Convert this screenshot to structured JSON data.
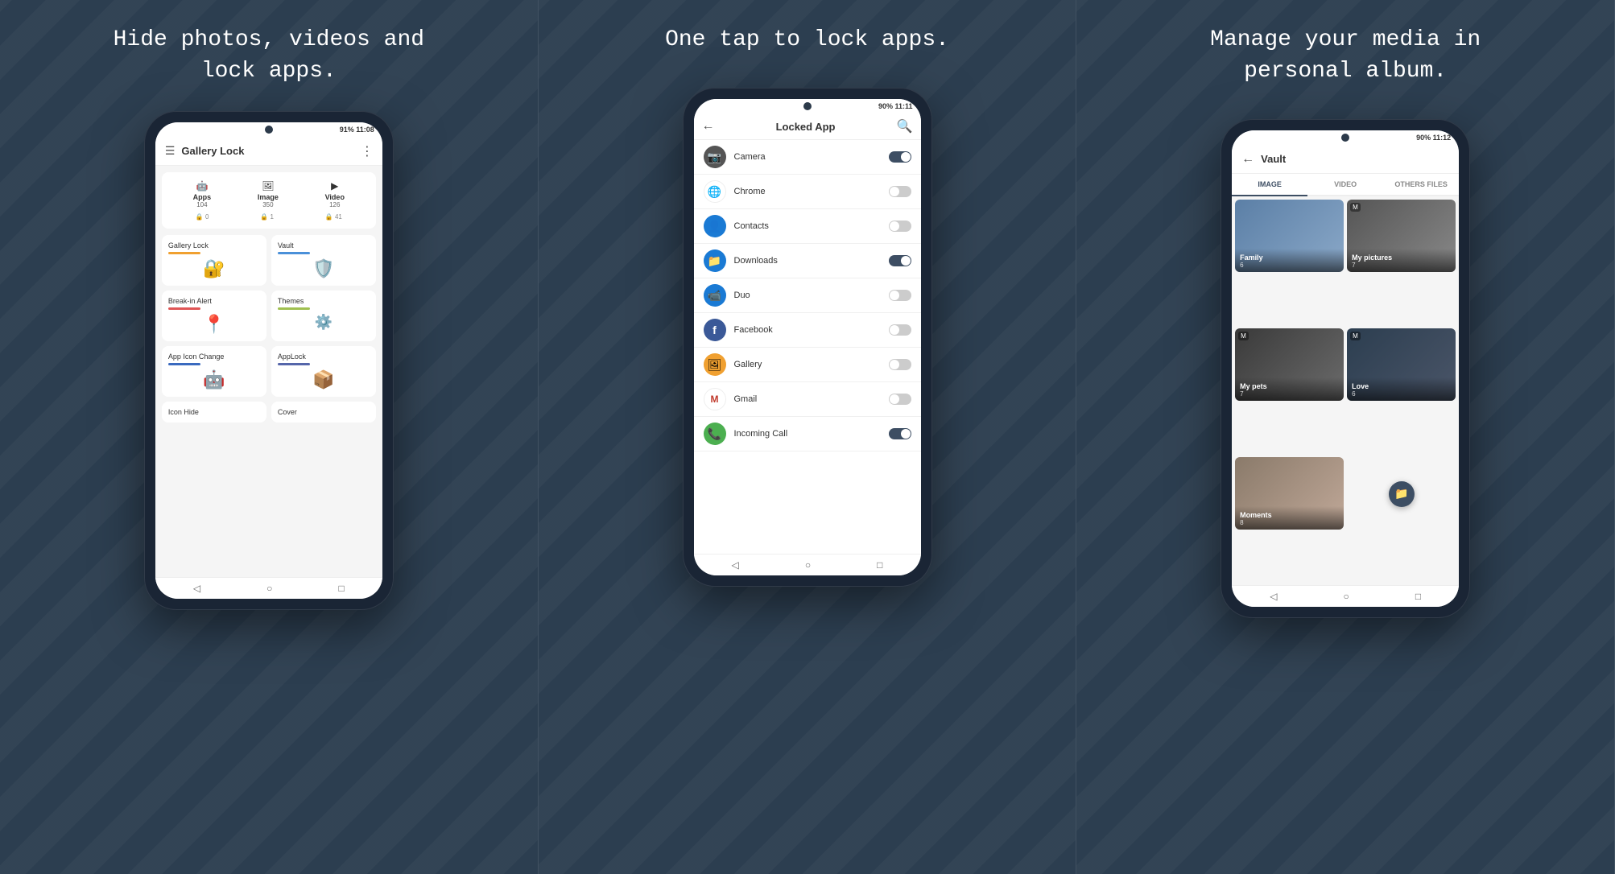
{
  "panel1": {
    "heading": "Hide photos, videos and\nlock apps.",
    "phone": {
      "status": "91%  11:08",
      "appbar_title": "Gallery Lock",
      "stats": [
        {
          "icon": "🤖",
          "label": "Apps",
          "count": "104"
        },
        {
          "icon": "🖼",
          "label": "Image",
          "count": "350"
        },
        {
          "icon": "▶",
          "label": "Video",
          "count": "126"
        }
      ],
      "locks": [
        "🔒 0",
        "🔒 1",
        "🔒 41"
      ],
      "menu_items": [
        {
          "title": "Gallery Lock",
          "bar_color": "#f0a030",
          "icon": "🔐"
        },
        {
          "title": "Vault",
          "bar_color": "#4a90d9",
          "icon": "🛡️"
        },
        {
          "title": "Break-in Alert",
          "bar_color": "#e05555",
          "icon": "📍"
        },
        {
          "title": "Themes",
          "bar_color": "#a0c050",
          "icon": "⚙️"
        },
        {
          "title": "App Icon Change",
          "bar_color": "#3a6abf",
          "icon": "🤖"
        },
        {
          "title": "AppLock",
          "bar_color": "#5566aa",
          "icon": "📦"
        },
        {
          "title": "Icon Hide",
          "bar_color": "",
          "icon": ""
        },
        {
          "title": "Cover",
          "bar_color": "",
          "icon": ""
        }
      ]
    }
  },
  "panel2": {
    "heading": "One tap to lock apps.",
    "phone": {
      "status": "90%  11:11",
      "appbar_title": "Locked App",
      "apps": [
        {
          "name": "Camera",
          "icon": "📷",
          "icon_bg": "#555",
          "toggle": "on"
        },
        {
          "name": "Chrome",
          "icon": "🌐",
          "icon_bg": "#e84040",
          "toggle": "off"
        },
        {
          "name": "Contacts",
          "icon": "👤",
          "icon_bg": "#1a7ad4",
          "toggle": "off"
        },
        {
          "name": "Downloads",
          "icon": "📁",
          "icon_bg": "#1a7ad4",
          "toggle": "on"
        },
        {
          "name": "Duo",
          "icon": "📹",
          "icon_bg": "#1a7ad4",
          "toggle": "off"
        },
        {
          "name": "Facebook",
          "icon": "f",
          "icon_bg": "#3b5998",
          "toggle": "off"
        },
        {
          "name": "Gallery",
          "icon": "🖼",
          "icon_bg": "#f0a030",
          "toggle": "off"
        },
        {
          "name": "Gmail",
          "icon": "M",
          "icon_bg": "#fff",
          "toggle": "off"
        },
        {
          "name": "Incoming Call",
          "icon": "📞",
          "icon_bg": "#4caf50",
          "toggle": "on"
        }
      ]
    }
  },
  "panel3": {
    "heading": "Manage your media in\npersonal album.",
    "phone": {
      "status": "90%  11:12",
      "appbar_title": "Vault",
      "tabs": [
        "IMAGE",
        "VIDEO",
        "OTHERS FILES"
      ],
      "albums": [
        {
          "name": "Family",
          "count": "6",
          "style": "album-family"
        },
        {
          "name": "My pictures",
          "count": "7",
          "style": "album-mypictures"
        },
        {
          "name": "My pets",
          "count": "7",
          "style": "album-mypets"
        },
        {
          "name": "Love",
          "count": "6",
          "style": "album-love"
        },
        {
          "name": "Moments",
          "count": "8",
          "style": "album-moments"
        }
      ]
    }
  }
}
